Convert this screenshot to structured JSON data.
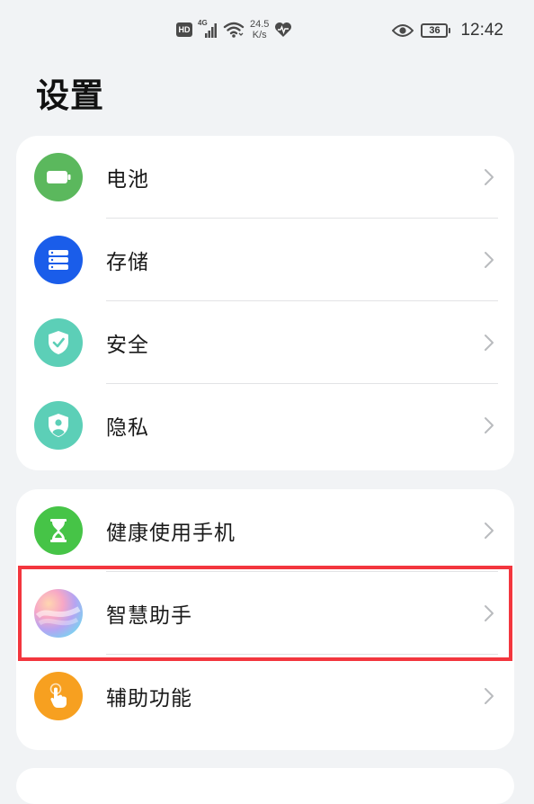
{
  "status_bar": {
    "hd": "HD",
    "network": "4G",
    "speed_value": "24.5",
    "speed_unit": "K/s",
    "battery_level": "36",
    "time": "12:42"
  },
  "title": "设置",
  "groups": [
    {
      "items": [
        {
          "label": "电池",
          "icon": "battery-icon"
        },
        {
          "label": "存储",
          "icon": "storage-icon"
        },
        {
          "label": "安全",
          "icon": "shield-icon"
        },
        {
          "label": "隐私",
          "icon": "privacy-icon"
        }
      ]
    },
    {
      "items": [
        {
          "label": "健康使用手机",
          "icon": "hourglass-icon"
        },
        {
          "label": "智慧助手",
          "icon": "assistant-icon"
        },
        {
          "label": "辅助功能",
          "icon": "hand-pointer-icon"
        }
      ]
    }
  ],
  "colors": {
    "background": "#f1f3f5",
    "battery": "#5bb85d",
    "storage": "#1a5dea",
    "security": "#5ccfb7",
    "health": "#46c447",
    "accessibility": "#f7a020",
    "highlight": "#f3363e"
  }
}
